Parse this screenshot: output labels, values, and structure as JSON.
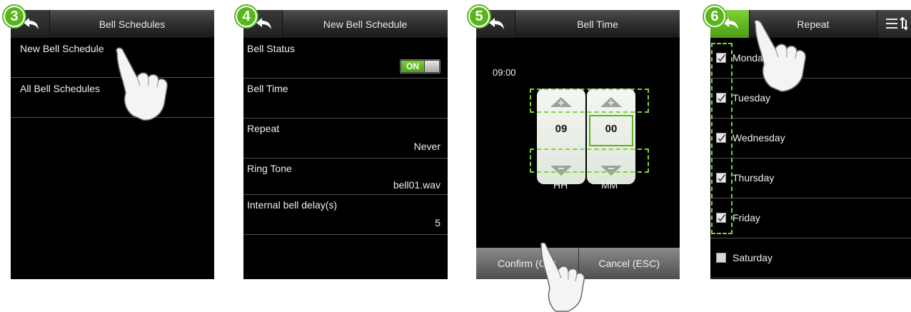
{
  "steps": [
    {
      "number": "3",
      "title": "Bell Schedules",
      "items": [
        "New Bell Schedule",
        "All Bell Schedules"
      ]
    },
    {
      "number": "4",
      "title": "New Bell Schedule",
      "rows": [
        {
          "label": "Bell Status",
          "toggle": "ON"
        },
        {
          "label": "Bell Time",
          "value": ""
        },
        {
          "label": "Repeat",
          "value": "Never"
        },
        {
          "label": "Ring Tone",
          "value": "bell01.wav"
        },
        {
          "label": "Internal bell delay(s)",
          "value": "5"
        }
      ]
    },
    {
      "number": "5",
      "title": "Bell Time",
      "time": "09:00",
      "hour": "09",
      "minute": "00",
      "hour_label": "HH",
      "minute_label": "MM",
      "confirm_label": "Confirm (OK)",
      "cancel_label": "Cancel (ESC)"
    },
    {
      "number": "6",
      "title": "Repeat",
      "days": [
        {
          "label": "Monday",
          "checked": true
        },
        {
          "label": "Tuesday",
          "checked": true
        },
        {
          "label": "Wednesday",
          "checked": true
        },
        {
          "label": "Thursday",
          "checked": true
        },
        {
          "label": "Friday",
          "checked": true
        },
        {
          "label": "Saturday",
          "checked": false
        }
      ]
    }
  ],
  "colors": {
    "accent": "#58b61c",
    "screen_bg": "#000000",
    "text": "#f0f0f0"
  },
  "icons": {
    "back": "back-arrow-icon",
    "sort": "sort-icon",
    "hand": "pointing-hand-icon"
  }
}
